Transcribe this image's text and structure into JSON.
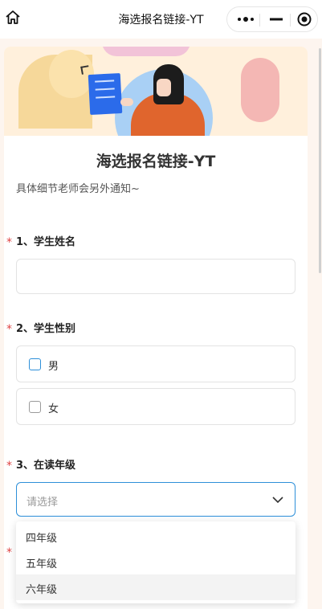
{
  "navbar": {
    "title": "海选报名链接-YT",
    "home_icon": "home-icon",
    "more_icon": "more-dots-icon",
    "minimize_icon": "minimize-icon",
    "close_icon": "close-target-icon"
  },
  "form": {
    "title": "海选报名链接-YT",
    "description": "具体细节老师会另外通知~",
    "required_mark": "*",
    "questions": [
      {
        "label": "1、学生姓名",
        "type": "text",
        "value": ""
      },
      {
        "label": "2、学生性别",
        "type": "checkbox",
        "options": [
          "男",
          "女"
        ]
      },
      {
        "label": "3、在读年级",
        "type": "select",
        "placeholder": "请选择",
        "options": [
          "四年级",
          "五年级",
          "六年级"
        ]
      }
    ]
  },
  "colors": {
    "accent": "#2d8fd9",
    "required": "#e04343",
    "banner_bg": "#fff0dc",
    "page_bg": "#fdf5ef"
  }
}
